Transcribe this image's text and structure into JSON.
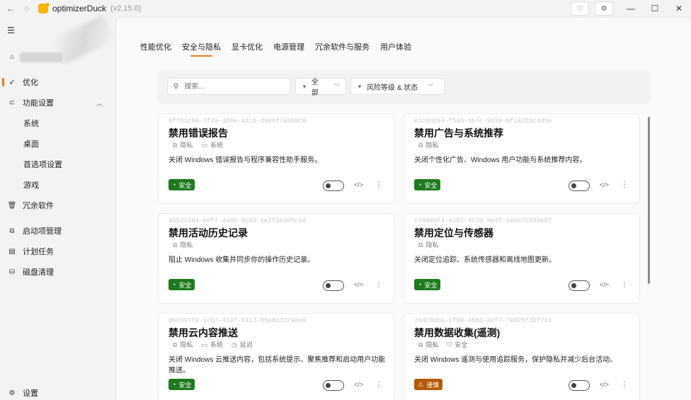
{
  "titlebar": {
    "app_name": "optimizerDuck",
    "version": "(v2.15.0)"
  },
  "sidebar": {
    "items": [
      {
        "label": "",
        "icon": "home-icon"
      },
      {
        "label": "优化",
        "icon": "rocket-icon"
      },
      {
        "label": "功能设置",
        "icon": "toggle-icon"
      },
      {
        "label": "系统"
      },
      {
        "label": "桌面"
      },
      {
        "label": "首选项设置"
      },
      {
        "label": "游戏"
      },
      {
        "label": "冗余软件",
        "icon": "trash-icon"
      },
      {
        "label": "启动项管理",
        "icon": "startup-icon"
      },
      {
        "label": "计划任务",
        "icon": "calendar-icon"
      },
      {
        "label": "磁盘清理",
        "icon": "disk-icon"
      },
      {
        "label": "设置",
        "icon": "gear-icon"
      }
    ],
    "active_index": 1
  },
  "tabs": [
    "性能优化",
    "安全与隐私",
    "显卡优化",
    "电源管理",
    "冗余软件与服务",
    "用户体验"
  ],
  "active_tab": 1,
  "filters": {
    "search_placeholder": "搜索...",
    "category_label": "全部",
    "risk_label": "风险等级 & 状态"
  },
  "cards": [
    {
      "id": "8f7b1c9a-7f2a-4b6e-a1c6-d9e6f7a5b8c0",
      "title": "禁用错误报告",
      "tags": [
        {
          "icon": "privacy-icon",
          "label": "隐私"
        },
        {
          "icon": "monitor-icon",
          "label": "系统"
        }
      ],
      "description": "关闭 Windows 错误报告与程序兼容性助手服务。",
      "badge": "安全",
      "badge_type": "safe"
    },
    {
      "id": "e1c8d2e4-f5ab-4b7c-9d3e-0f1a2b3c4d5e",
      "title": "禁用广告与系统推荐",
      "tags": [
        {
          "icon": "privacy-icon",
          "label": "隐私"
        }
      ],
      "description": "关闭个性化广告、Windows 用户功能与系统推荐内容。",
      "badge": "安全",
      "badge_type": "safe"
    },
    {
      "id": "a5b2c3d4-e6f7-4a8b-9c0d-1e2f3a4b5c6d",
      "title": "禁用活动历史记录",
      "tags": [
        {
          "icon": "privacy-icon",
          "label": "隐私"
        }
      ],
      "description": "阻止 Windows 收集并同步你的操作历史记录。",
      "badge": "安全",
      "badge_type": "safe"
    },
    {
      "id": "c7d8e9f4-a1b2-4c3d-8e4f-5a6b7c8d9e0f",
      "title": "禁用定位与传感器",
      "tags": [
        {
          "icon": "privacy-icon",
          "label": "隐私"
        }
      ],
      "description": "关闭定位追踪、系统传感器和离线地图更新。",
      "badge": "安全",
      "badge_type": "safe"
    },
    {
      "id": "0bc997fe-1cb7-41ef-b413-85e81337aee8",
      "title": "禁用云内容推送",
      "tags": [
        {
          "icon": "privacy-icon",
          "label": "隐私"
        },
        {
          "icon": "monitor-icon",
          "label": "系统"
        },
        {
          "icon": "clock-icon",
          "label": "延迟"
        }
      ],
      "description": "关闭 Windows 云推送内容，包括系统提示、聚焦推荐和启动用户功能推送。",
      "badge": "安全",
      "badge_type": "safe"
    },
    {
      "id": "7d4c8dba-1f90-4bbd-aef7-7e025f4bf71e",
      "title": "禁用数据收集(遥测)",
      "tags": [
        {
          "icon": "privacy-icon",
          "label": "隐私"
        },
        {
          "icon": "shield-icon",
          "label": "安全"
        }
      ],
      "description": "关闭 Windows 遥测与使用追踪服务，保护隐私并减少后台活动。",
      "badge": "谨慎",
      "badge_type": "caution"
    }
  ]
}
